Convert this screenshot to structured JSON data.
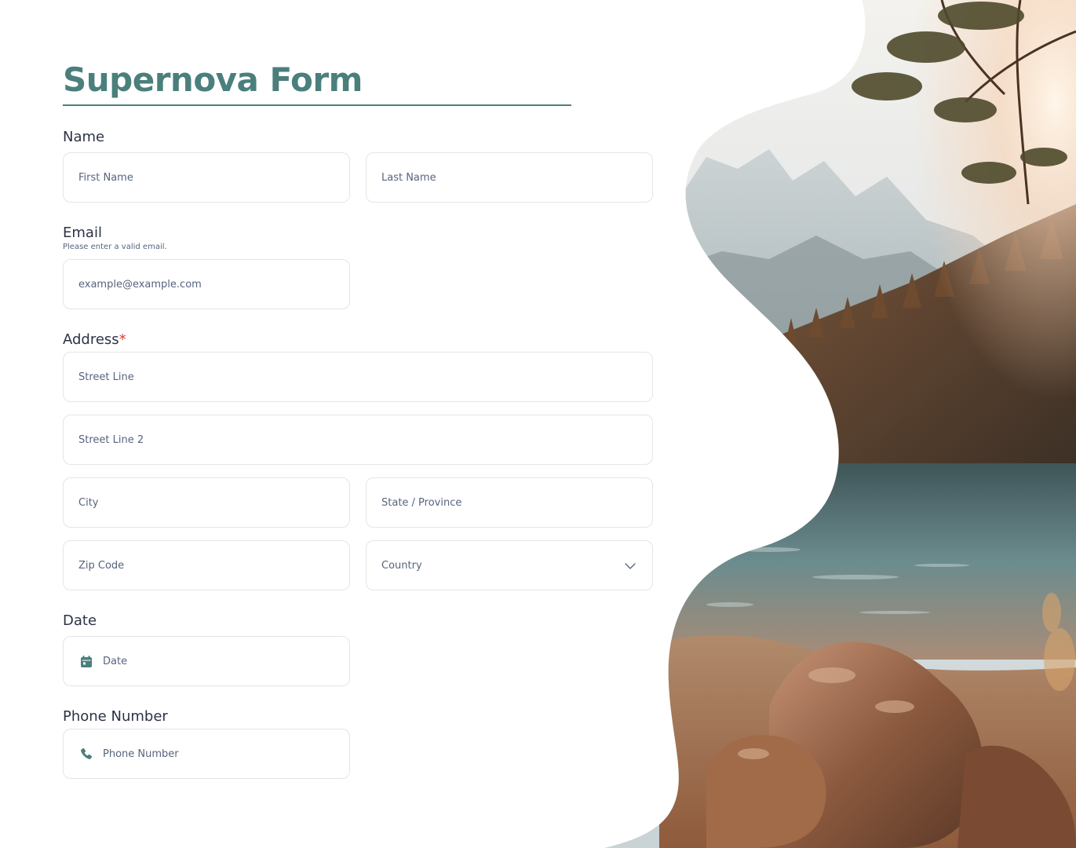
{
  "form": {
    "title": "Supernova Form",
    "accent_color": "#4a7f7c",
    "name": {
      "label": "Name",
      "first_placeholder": "First Name",
      "last_placeholder": "Last Name"
    },
    "email": {
      "label": "Email",
      "sublabel": "Please enter a valid email.",
      "placeholder": "example@example.com"
    },
    "address": {
      "label": "Address",
      "required_mark": "*",
      "street1_placeholder": "Street Line",
      "street2_placeholder": "Street Line 2",
      "city_placeholder": "City",
      "state_placeholder": "State / Province",
      "zip_placeholder": "Zip Code",
      "country_placeholder": "Country"
    },
    "date": {
      "label": "Date",
      "placeholder": "Date",
      "icon": "calendar-icon"
    },
    "phone": {
      "label": "Phone Number",
      "placeholder": "Phone Number",
      "icon": "phone-icon"
    }
  },
  "scenery": {
    "description_icon": "landscape-image"
  }
}
